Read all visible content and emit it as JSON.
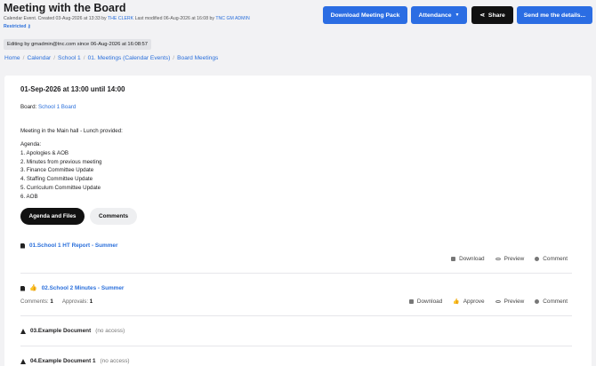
{
  "header": {
    "title": "Meeting with the Board",
    "meta_prefix": "Calendar Event. Created 03-Aug-2026 at 13:33 by",
    "created_by": "THE CLERK",
    "meta_mid": "Last modified 06-Aug-2026 at 16:08 by",
    "modified_by": "TNC GM ADMIN",
    "restricted_label": "Restricted"
  },
  "toolbar": {
    "download_pack": "Download Meeting Pack",
    "attendance": "Attendance",
    "share": "Share",
    "send_details": "Send me the details..."
  },
  "editing_notice": "Editing by gmadmin@tnc.com since 06-Aug-2026 at 16:08:57",
  "breadcrumbs": [
    "Home",
    "Calendar",
    "School 1",
    "01. Meetings (Calendar Events)",
    "Board Meetings"
  ],
  "event": {
    "when": "01-Sep-2026 at 13:00 until 14:00",
    "board_label": "Board:",
    "board_value": "School 1 Board",
    "description": "Meeting in the Main hall - Lunch provided:",
    "agenda_heading": "Agenda:",
    "agenda_items": [
      "1. Apologies & AOB",
      "2. Minutes from previous meeting",
      "3. Finance Committee Update",
      "4. Staffing Committee Update",
      "5. Curriculum Committee Update",
      "6. AOB"
    ]
  },
  "tabs": {
    "agenda": "Agenda and Files",
    "comments": "Comments"
  },
  "documents": [
    {
      "name": "01.School 1 HT Report - Summer",
      "actions": [
        "Download",
        "Preview",
        "Comment"
      ]
    },
    {
      "name": "02.School 2 Minutes - Summer",
      "comments_label": "Comments:",
      "comments_count": "1",
      "approvals_label": "Approvals:",
      "approvals_count": "1",
      "actions": [
        "Download",
        "Approve",
        "Preview",
        "Comment"
      ]
    },
    {
      "name": "03.Example Document",
      "access": "(no access)"
    },
    {
      "name": "04.Example Document 1",
      "access": "(no access)"
    }
  ]
}
